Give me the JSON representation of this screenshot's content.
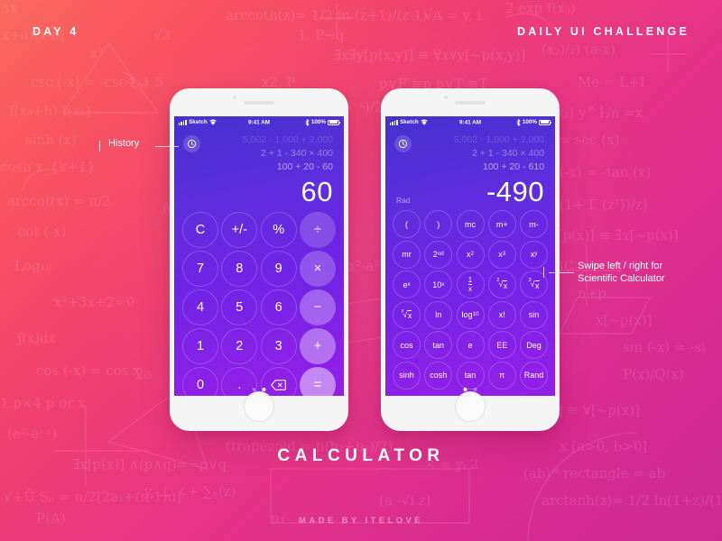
{
  "header": {
    "left": "DAY 4",
    "right": "DAILY UI CHALLENGE"
  },
  "footer": {
    "title": "CALCULATOR",
    "credit": "MADE BY ITELOVE"
  },
  "annotations": {
    "history": "History",
    "swipe_line1": "Swipe left / right for",
    "swipe_line2": "Scientific Calculator"
  },
  "statusbar": {
    "carrier": "Sketch",
    "time": "9:41 AM",
    "battery": "100%"
  },
  "colors": {
    "bg_start": "#fb6a5e",
    "bg_end": "#cc2a92",
    "screen_top": "#4530cf",
    "screen_bottom": "#931fe6",
    "phone_body": "#f6f5f6",
    "text": "#ffffff"
  },
  "phone1": {
    "icon": "history-clock-icon",
    "history": [
      "5,002 - 1,000 + 2,000",
      "2 + 1 - 340 × 400",
      "100 + 20 - 60"
    ],
    "result": "60",
    "page_dots": [
      false,
      true
    ],
    "keys": [
      [
        {
          "label": "C",
          "name": "clear",
          "style": "num"
        },
        {
          "label": "+/-",
          "name": "sign-toggle",
          "style": "num"
        },
        {
          "label": "%",
          "name": "percent",
          "style": "num"
        },
        {
          "label": "÷",
          "name": "divide",
          "style": "op op-1"
        }
      ],
      [
        {
          "label": "7",
          "name": "digit-7",
          "style": "num"
        },
        {
          "label": "8",
          "name": "digit-8",
          "style": "num"
        },
        {
          "label": "9",
          "name": "digit-9",
          "style": "num"
        },
        {
          "label": "×",
          "name": "multiply",
          "style": "op op-2"
        }
      ],
      [
        {
          "label": "4",
          "name": "digit-4",
          "style": "num"
        },
        {
          "label": "5",
          "name": "digit-5",
          "style": "num"
        },
        {
          "label": "6",
          "name": "digit-6",
          "style": "num"
        },
        {
          "label": "−",
          "name": "subtract",
          "style": "op op-3"
        }
      ],
      [
        {
          "label": "1",
          "name": "digit-1",
          "style": "num"
        },
        {
          "label": "2",
          "name": "digit-2",
          "style": "num"
        },
        {
          "label": "3",
          "name": "digit-3",
          "style": "num"
        },
        {
          "label": "+",
          "name": "add",
          "style": "op op-4"
        }
      ],
      [
        {
          "label": "0",
          "name": "digit-0",
          "style": "num"
        },
        {
          "label": ".",
          "name": "decimal-point",
          "style": "num"
        },
        {
          "label": "",
          "name": "backspace-icon",
          "style": "num",
          "icon": "backspace"
        },
        {
          "label": "=",
          "name": "equals",
          "style": "op op-5"
        }
      ]
    ]
  },
  "phone2": {
    "icon": "history-clock-icon",
    "history": [
      "5,002 - 1,000 + 2,000",
      "2 + 1 - 340 × 400",
      "100 + 20 - 610"
    ],
    "result": "-490",
    "angle_mode": "Rad",
    "page_dots": [
      true,
      false
    ],
    "keys": [
      [
        {
          "label": "(",
          "name": "paren-open"
        },
        {
          "label": ")",
          "name": "paren-close"
        },
        {
          "label": "mc",
          "name": "memory-clear"
        },
        {
          "label": "m+",
          "name": "memory-add"
        },
        {
          "label": "m-",
          "name": "memory-subtract"
        }
      ],
      [
        {
          "label": "mr",
          "name": "memory-recall"
        },
        {
          "label": "2nd",
          "name": "second-function",
          "sup": "nd",
          "base": "2"
        },
        {
          "label": "x²",
          "name": "x-squared",
          "sup": "2",
          "base": "x"
        },
        {
          "label": "x³",
          "name": "x-cubed",
          "sup": "3",
          "base": "x"
        },
        {
          "label": "xʸ",
          "name": "x-power-y",
          "sup": "y",
          "base": "x"
        }
      ],
      [
        {
          "label": "eˣ",
          "name": "e-power-x",
          "sup": "x",
          "base": "e"
        },
        {
          "label": "10ˣ",
          "name": "ten-power-x",
          "sup": "x",
          "base": "10"
        },
        {
          "label": "1/x",
          "name": "reciprocal",
          "frac": [
            "1",
            "x"
          ]
        },
        {
          "label": "²√x",
          "name": "square-root",
          "root": [
            "2",
            "x"
          ]
        },
        {
          "label": "³√x",
          "name": "cube-root",
          "root": [
            "3",
            "x"
          ]
        }
      ],
      [
        {
          "label": "ʸ√x",
          "name": "nth-root",
          "root": [
            "y",
            "x"
          ]
        },
        {
          "label": "ln",
          "name": "natural-log"
        },
        {
          "label": "log10",
          "name": "log-base-10",
          "sub": "10",
          "base": "log"
        },
        {
          "label": "x!",
          "name": "factorial"
        },
        {
          "label": "sin",
          "name": "sine"
        }
      ],
      [
        {
          "label": "cos",
          "name": "cosine"
        },
        {
          "label": "tan",
          "name": "tangent"
        },
        {
          "label": "e",
          "name": "euler-number"
        },
        {
          "label": "EE",
          "name": "exponent-entry"
        },
        {
          "label": "Deg",
          "name": "degree-mode"
        }
      ],
      [
        {
          "label": "sinh",
          "name": "hyperbolic-sine"
        },
        {
          "label": "cosh",
          "name": "hyperbolic-cosine"
        },
        {
          "label": "tan",
          "name": "hyperbolic-tangent"
        },
        {
          "label": "π",
          "name": "pi-constant"
        },
        {
          "label": "Rand",
          "name": "random-number"
        }
      ]
    ]
  }
}
